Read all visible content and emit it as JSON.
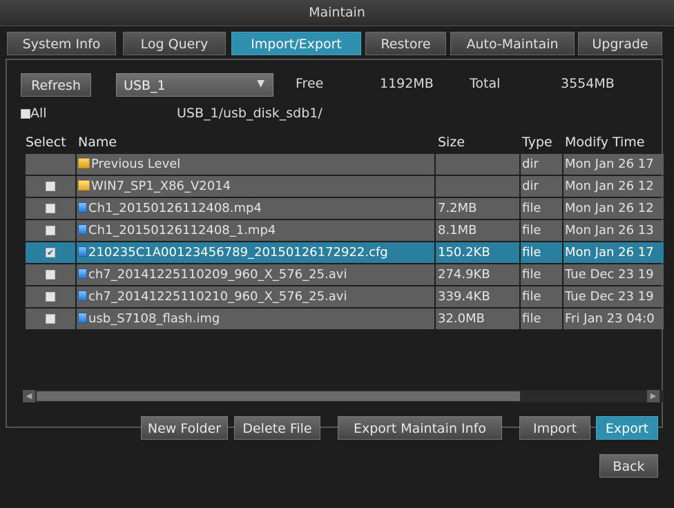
{
  "window": {
    "title": "Maintain"
  },
  "tabs": [
    {
      "label": "System Info",
      "active": false
    },
    {
      "label": "Log Query",
      "active": false
    },
    {
      "label": "Import/Export",
      "active": true
    },
    {
      "label": "Restore",
      "active": false
    },
    {
      "label": "Auto-Maintain",
      "active": false
    },
    {
      "label": "Upgrade",
      "active": false
    }
  ],
  "toolbar": {
    "refresh_label": "Refresh",
    "device": "USB_1",
    "free_label": "Free",
    "free_value": "1192MB",
    "total_label": "Total",
    "total_value": "3554MB"
  },
  "path_bar": {
    "all_label": "All",
    "path": "USB_1/usb_disk_sdb1/"
  },
  "table": {
    "headers": {
      "select": "Select",
      "name": "Name",
      "size": "Size",
      "type": "Type",
      "modify": "Modify Time"
    },
    "rows": [
      {
        "name": "Previous Level",
        "size": "",
        "type": "dir",
        "modify": "Mon Jan 26 17",
        "icon": "folder-up-icon",
        "checkbox": false,
        "selected": false
      },
      {
        "name": "WIN7_SP1_X86_V2014",
        "size": "",
        "type": "dir",
        "modify": "Mon Jan 26 12",
        "icon": "folder-icon",
        "checkbox": true,
        "selected": false
      },
      {
        "name": "Ch1_20150126112408.mp4",
        "size": "7.2MB",
        "type": "file",
        "modify": "Mon Jan 26 12",
        "icon": "file-icon",
        "checkbox": true,
        "selected": false
      },
      {
        "name": "Ch1_20150126112408_1.mp4",
        "size": "8.1MB",
        "type": "file",
        "modify": "Mon Jan 26 13",
        "icon": "file-icon",
        "checkbox": true,
        "selected": false
      },
      {
        "name": "210235C1A00123456789_20150126172922.cfg",
        "size": "150.2KB",
        "type": "file",
        "modify": "Mon Jan 26 17",
        "icon": "file-icon",
        "checkbox": true,
        "selected": true
      },
      {
        "name": "ch7_20141225110209_960_X_576_25.avi",
        "size": "274.9KB",
        "type": "file",
        "modify": "Tue Dec 23 19",
        "icon": "file-icon",
        "checkbox": true,
        "selected": false
      },
      {
        "name": "ch7_20141225110210_960_X_576_25.avi",
        "size": "339.4KB",
        "type": "file",
        "modify": "Tue Dec 23 19",
        "icon": "file-icon",
        "checkbox": true,
        "selected": false
      },
      {
        "name": "usb_S7108_flash.img",
        "size": "32.0MB",
        "type": "file",
        "modify": "Fri Jan 23 04:0",
        "icon": "file-icon",
        "checkbox": true,
        "selected": false
      }
    ]
  },
  "actions": {
    "new_folder": "New Folder",
    "delete_file": "Delete File",
    "export_maintain_info": "Export Maintain Info",
    "import": "Import",
    "export": "Export"
  },
  "footer": {
    "back": "Back"
  },
  "colors": {
    "accent": "#2f8fae",
    "selected_row": "#2b7f9e",
    "row_bg": "#5e5e5e"
  }
}
